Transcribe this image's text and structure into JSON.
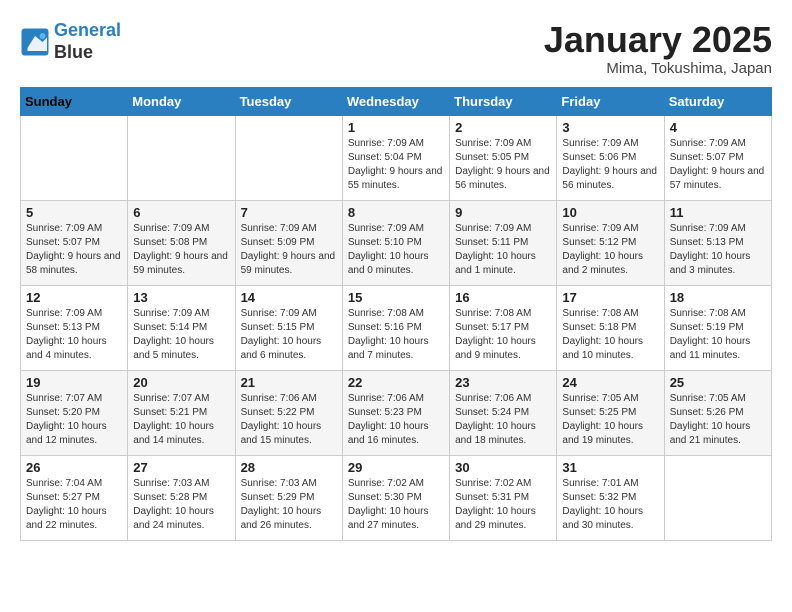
{
  "header": {
    "logo_line1": "General",
    "logo_line2": "Blue",
    "month_title": "January 2025",
    "location": "Mima, Tokushima, Japan"
  },
  "weekdays": [
    "Sunday",
    "Monday",
    "Tuesday",
    "Wednesday",
    "Thursday",
    "Friday",
    "Saturday"
  ],
  "weeks": [
    [
      {
        "day": "",
        "info": ""
      },
      {
        "day": "",
        "info": ""
      },
      {
        "day": "",
        "info": ""
      },
      {
        "day": "1",
        "info": "Sunrise: 7:09 AM\nSunset: 5:04 PM\nDaylight: 9 hours and 55 minutes."
      },
      {
        "day": "2",
        "info": "Sunrise: 7:09 AM\nSunset: 5:05 PM\nDaylight: 9 hours and 56 minutes."
      },
      {
        "day": "3",
        "info": "Sunrise: 7:09 AM\nSunset: 5:06 PM\nDaylight: 9 hours and 56 minutes."
      },
      {
        "day": "4",
        "info": "Sunrise: 7:09 AM\nSunset: 5:07 PM\nDaylight: 9 hours and 57 minutes."
      }
    ],
    [
      {
        "day": "5",
        "info": "Sunrise: 7:09 AM\nSunset: 5:07 PM\nDaylight: 9 hours and 58 minutes."
      },
      {
        "day": "6",
        "info": "Sunrise: 7:09 AM\nSunset: 5:08 PM\nDaylight: 9 hours and 59 minutes."
      },
      {
        "day": "7",
        "info": "Sunrise: 7:09 AM\nSunset: 5:09 PM\nDaylight: 9 hours and 59 minutes."
      },
      {
        "day": "8",
        "info": "Sunrise: 7:09 AM\nSunset: 5:10 PM\nDaylight: 10 hours and 0 minutes."
      },
      {
        "day": "9",
        "info": "Sunrise: 7:09 AM\nSunset: 5:11 PM\nDaylight: 10 hours and 1 minute."
      },
      {
        "day": "10",
        "info": "Sunrise: 7:09 AM\nSunset: 5:12 PM\nDaylight: 10 hours and 2 minutes."
      },
      {
        "day": "11",
        "info": "Sunrise: 7:09 AM\nSunset: 5:13 PM\nDaylight: 10 hours and 3 minutes."
      }
    ],
    [
      {
        "day": "12",
        "info": "Sunrise: 7:09 AM\nSunset: 5:13 PM\nDaylight: 10 hours and 4 minutes."
      },
      {
        "day": "13",
        "info": "Sunrise: 7:09 AM\nSunset: 5:14 PM\nDaylight: 10 hours and 5 minutes."
      },
      {
        "day": "14",
        "info": "Sunrise: 7:09 AM\nSunset: 5:15 PM\nDaylight: 10 hours and 6 minutes."
      },
      {
        "day": "15",
        "info": "Sunrise: 7:08 AM\nSunset: 5:16 PM\nDaylight: 10 hours and 7 minutes."
      },
      {
        "day": "16",
        "info": "Sunrise: 7:08 AM\nSunset: 5:17 PM\nDaylight: 10 hours and 9 minutes."
      },
      {
        "day": "17",
        "info": "Sunrise: 7:08 AM\nSunset: 5:18 PM\nDaylight: 10 hours and 10 minutes."
      },
      {
        "day": "18",
        "info": "Sunrise: 7:08 AM\nSunset: 5:19 PM\nDaylight: 10 hours and 11 minutes."
      }
    ],
    [
      {
        "day": "19",
        "info": "Sunrise: 7:07 AM\nSunset: 5:20 PM\nDaylight: 10 hours and 12 minutes."
      },
      {
        "day": "20",
        "info": "Sunrise: 7:07 AM\nSunset: 5:21 PM\nDaylight: 10 hours and 14 minutes."
      },
      {
        "day": "21",
        "info": "Sunrise: 7:06 AM\nSunset: 5:22 PM\nDaylight: 10 hours and 15 minutes."
      },
      {
        "day": "22",
        "info": "Sunrise: 7:06 AM\nSunset: 5:23 PM\nDaylight: 10 hours and 16 minutes."
      },
      {
        "day": "23",
        "info": "Sunrise: 7:06 AM\nSunset: 5:24 PM\nDaylight: 10 hours and 18 minutes."
      },
      {
        "day": "24",
        "info": "Sunrise: 7:05 AM\nSunset: 5:25 PM\nDaylight: 10 hours and 19 minutes."
      },
      {
        "day": "25",
        "info": "Sunrise: 7:05 AM\nSunset: 5:26 PM\nDaylight: 10 hours and 21 minutes."
      }
    ],
    [
      {
        "day": "26",
        "info": "Sunrise: 7:04 AM\nSunset: 5:27 PM\nDaylight: 10 hours and 22 minutes."
      },
      {
        "day": "27",
        "info": "Sunrise: 7:03 AM\nSunset: 5:28 PM\nDaylight: 10 hours and 24 minutes."
      },
      {
        "day": "28",
        "info": "Sunrise: 7:03 AM\nSunset: 5:29 PM\nDaylight: 10 hours and 26 minutes."
      },
      {
        "day": "29",
        "info": "Sunrise: 7:02 AM\nSunset: 5:30 PM\nDaylight: 10 hours and 27 minutes."
      },
      {
        "day": "30",
        "info": "Sunrise: 7:02 AM\nSunset: 5:31 PM\nDaylight: 10 hours and 29 minutes."
      },
      {
        "day": "31",
        "info": "Sunrise: 7:01 AM\nSunset: 5:32 PM\nDaylight: 10 hours and 30 minutes."
      },
      {
        "day": "",
        "info": ""
      }
    ]
  ]
}
